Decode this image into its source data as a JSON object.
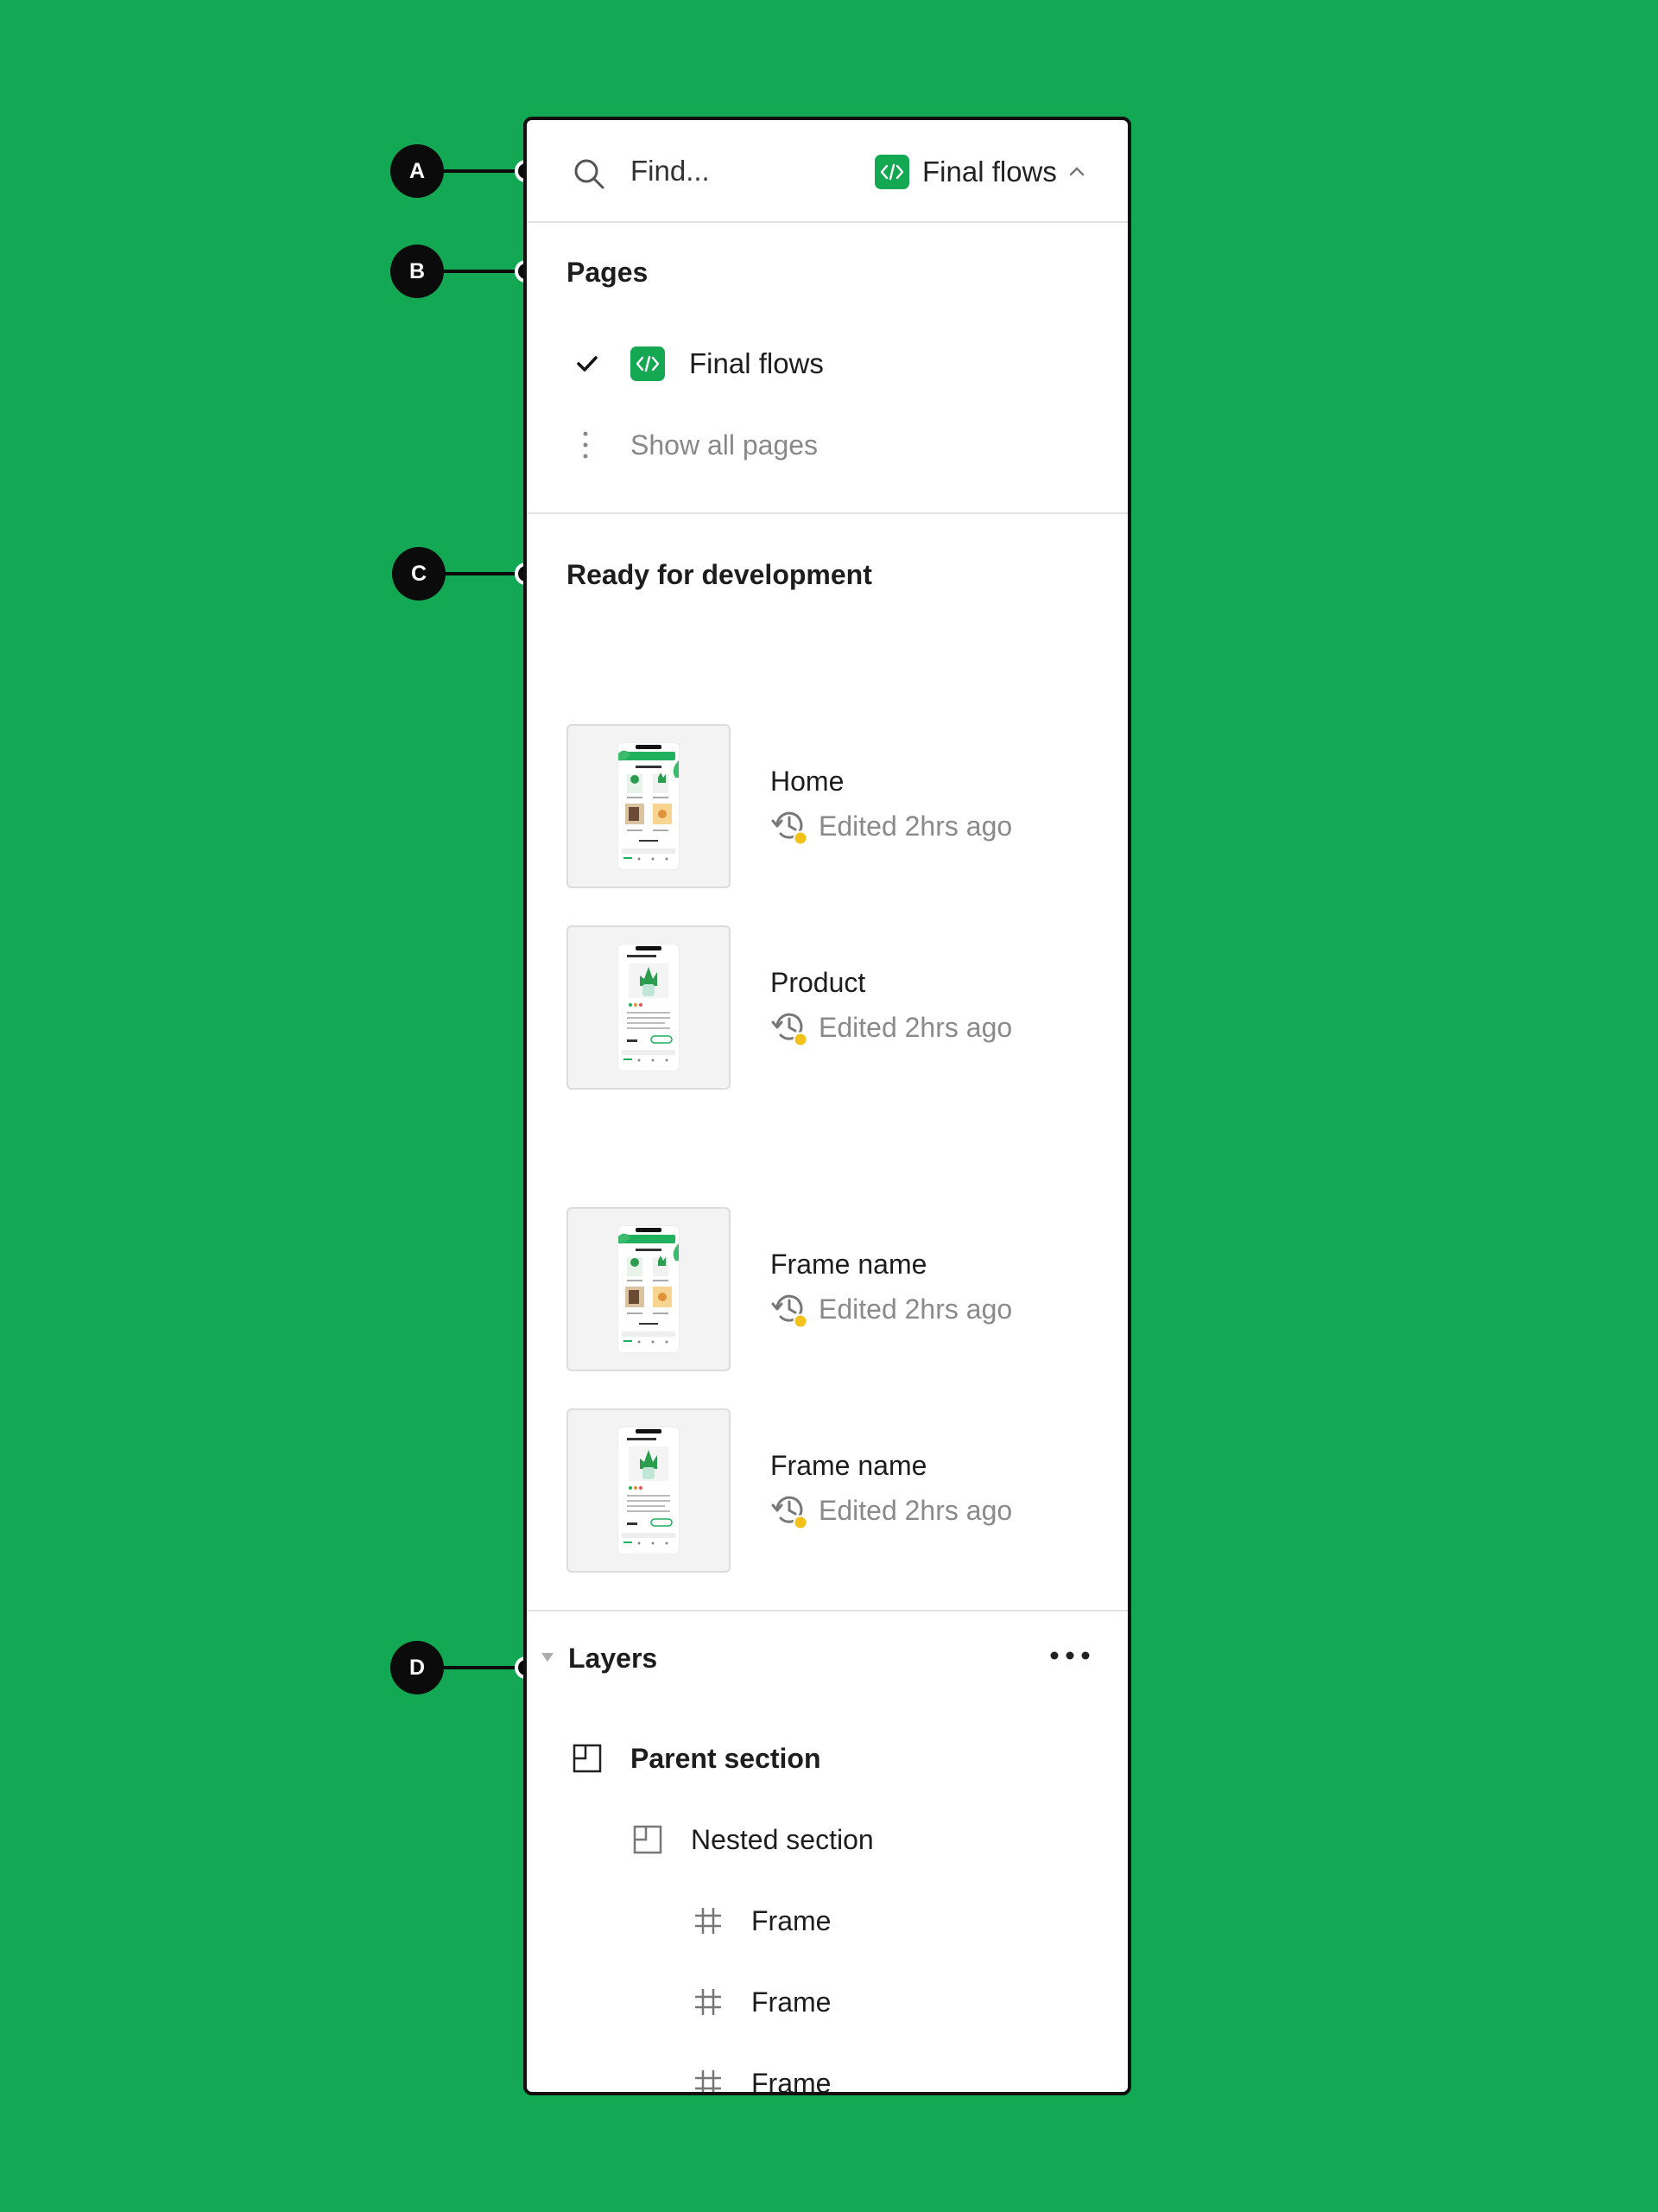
{
  "search": {
    "placeholder": "Find..."
  },
  "header": {
    "current_page": "Final flows"
  },
  "pages": {
    "title": "Pages",
    "items": [
      {
        "label": "Final flows",
        "selected": true
      }
    ],
    "show_all_label": "Show all pages"
  },
  "ready": {
    "title": "Ready for development",
    "frames": [
      {
        "name": "Home",
        "edited": "Edited 2hrs ago"
      },
      {
        "name": "Product",
        "edited": "Edited 2hrs ago"
      },
      {
        "name": "Frame name",
        "edited": "Edited 2hrs ago"
      },
      {
        "name": "Frame name",
        "edited": "Edited 2hrs ago"
      }
    ]
  },
  "layers": {
    "title": "Layers",
    "items": [
      {
        "label": "Parent section",
        "icon": "section-icon",
        "bold": true
      },
      {
        "label": "Nested section",
        "icon": "section-icon"
      },
      {
        "label": "Frame",
        "icon": "frame-hash-icon"
      },
      {
        "label": "Frame",
        "icon": "frame-hash-icon"
      },
      {
        "label": "Frame",
        "icon": "frame-hash-icon"
      }
    ]
  },
  "callouts": [
    "A",
    "B",
    "C",
    "D"
  ],
  "colors": {
    "background": "#12a854",
    "badge": "#14a853",
    "status_dot": "#f2c21b"
  }
}
